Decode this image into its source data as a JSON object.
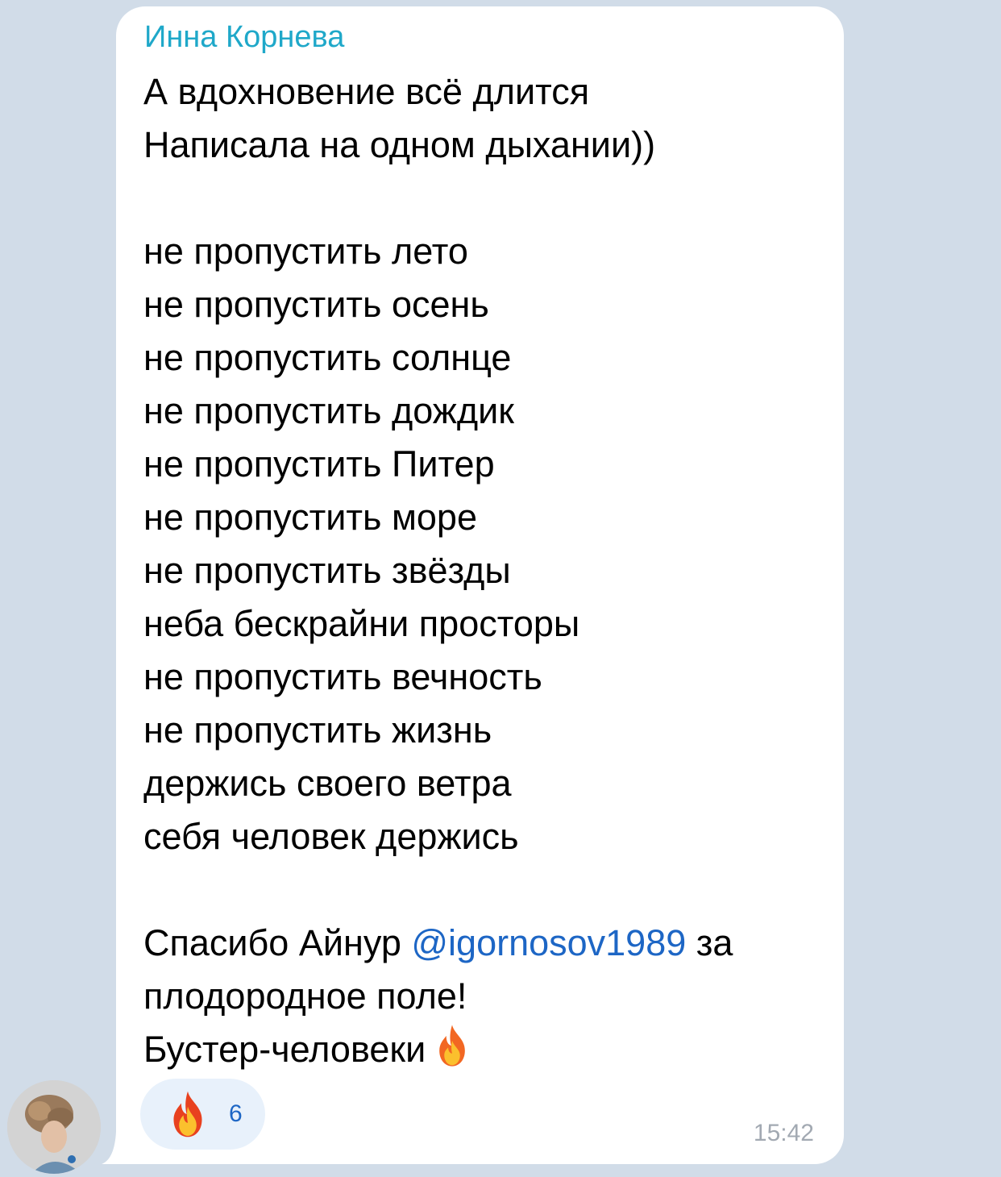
{
  "message": {
    "sender": "Инна Корнева",
    "lines": [
      "А вдохновение всё длится",
      "Написала на одном дыхании))",
      "",
      "не пропустить лето",
      "не пропустить осень",
      "не пропустить солнце",
      "не пропустить дождик",
      "не пропустить Питер",
      "не пропустить море",
      "не пропустить звёзды",
      "неба бескрайни просторы",
      "не пропустить вечность",
      "не пропустить жизнь",
      "держись своего ветра",
      "себя человек держись",
      ""
    ],
    "thanks_before": "Спасибо Айнур ",
    "mention": "@igornosov1989",
    "thanks_after": " за",
    "line_field": "плодородное поле!",
    "line_booster": "Бустер-человеки",
    "time": "15:42",
    "reaction": {
      "icon": "fire-icon",
      "count": "6"
    }
  },
  "colors": {
    "background": "#d1dce8",
    "bubble": "#ffffff",
    "sender": "#1fa8c9",
    "mention": "#1d66c5",
    "reaction_bg": "#e8f1fb",
    "time": "#a2a9b2"
  }
}
